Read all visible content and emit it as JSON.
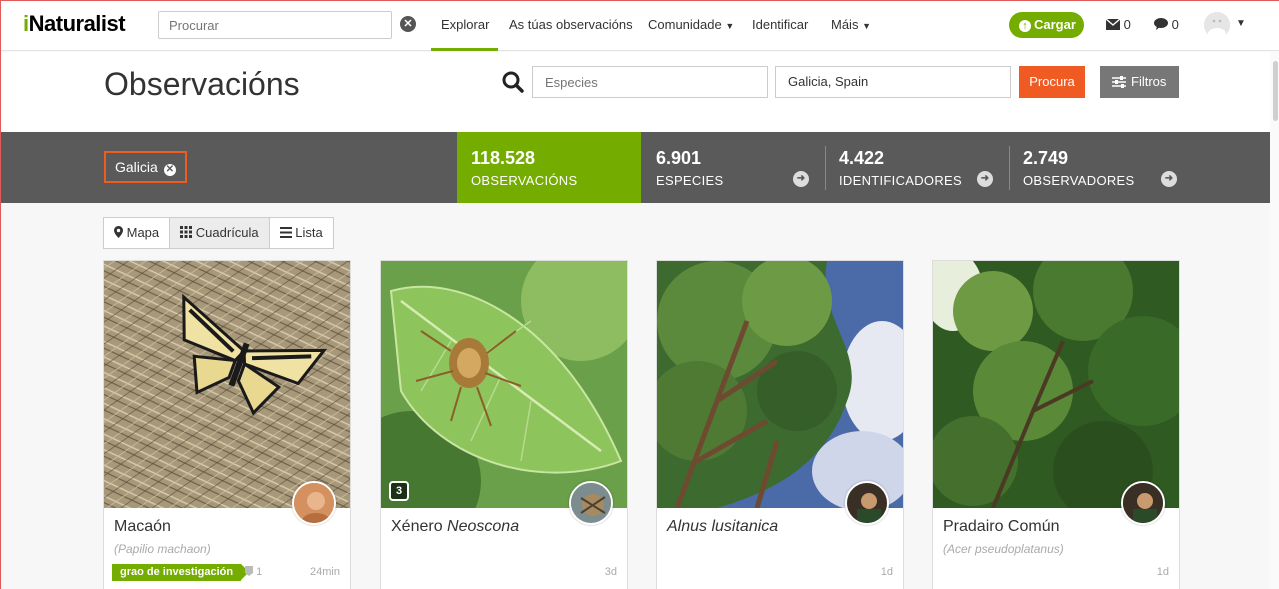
{
  "nav": {
    "logo_i": "i",
    "logo_rest": "Naturalist",
    "search_placeholder": "Procurar",
    "items": [
      "Explorar",
      "As túas observacións",
      "Comunidade",
      "Identificar",
      "Máis"
    ],
    "upload_label": "Cargar",
    "messages_count": "0",
    "notifications_count": "0"
  },
  "header": {
    "title": "Observacións",
    "species_placeholder": "Especies",
    "place_value": "Galicia, Spain",
    "search_button": "Procura",
    "filters_button": "Filtros"
  },
  "stats": {
    "place_chip": "Galicia",
    "observations": {
      "value": "118.528",
      "label": "OBSERVACIÓNS"
    },
    "species": {
      "value": "6.901",
      "label": "ESPECIES"
    },
    "identifiers": {
      "value": "4.422",
      "label": "IDENTIFICADORES"
    },
    "observers": {
      "value": "2.749",
      "label": "OBSERVADORES"
    }
  },
  "views": {
    "map": "Mapa",
    "grid": "Cuadrícula",
    "list": "Lista"
  },
  "cards": [
    {
      "name": "Macaón",
      "scientific": "(Papilio machaon)",
      "badge": "grao de investigación",
      "ids": "1",
      "time": "24min"
    },
    {
      "name_prefix": "Xénero ",
      "name_italic": "Neoscona",
      "photo_count": "3",
      "time": "3d"
    },
    {
      "name_italic": "Alnus lusitanica",
      "time": "1d"
    },
    {
      "name": "Pradairo Común",
      "scientific": "(Acer pseudoplatanus)",
      "time": "1d"
    }
  ],
  "colors": {
    "brand_green": "#74ac00",
    "accent_orange": "#f05a23",
    "stats_gray": "#5a5a5a"
  }
}
